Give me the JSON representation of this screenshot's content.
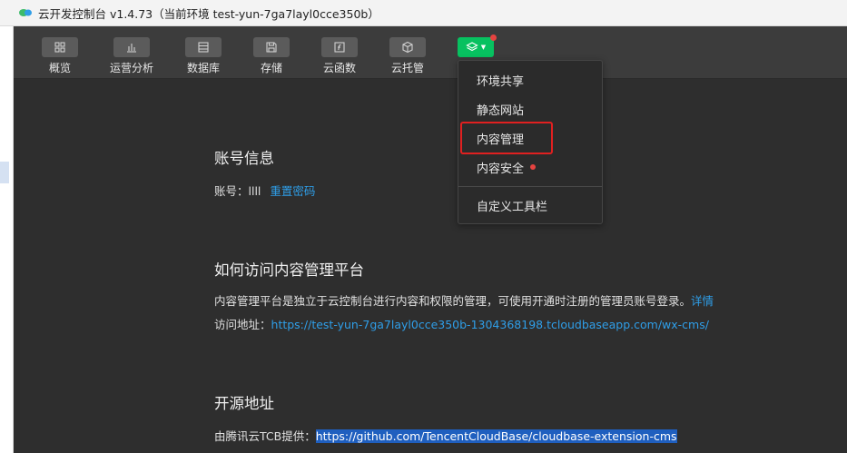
{
  "window": {
    "title": "云开发控制台 v1.4.73（当前环境 test-yun-7ga7layl0cce350b）"
  },
  "toolbar": {
    "items": [
      {
        "label": "概览",
        "icon": "grid-icon"
      },
      {
        "label": "运营分析",
        "icon": "bar-chart-icon"
      },
      {
        "label": "数据库",
        "icon": "database-icon"
      },
      {
        "label": "存储",
        "icon": "save-icon"
      },
      {
        "label": "云函数",
        "icon": "function-icon"
      },
      {
        "label": "云托管",
        "icon": "cube-icon"
      }
    ],
    "extensions_icon": "layers-icon"
  },
  "menu": {
    "items": [
      "环境共享",
      "静态网站",
      "内容管理",
      "内容安全",
      "自定义工具栏"
    ],
    "selected": "内容管理"
  },
  "account": {
    "title": "账号信息",
    "label": "账号：",
    "value": "llll",
    "reset_link": "重置密码"
  },
  "access": {
    "title": "如何访问内容管理平台",
    "description": "内容管理平台是独立于云控制台进行内容和权限的管理，可使用开通时注册的管理员账号登录。",
    "details_link": "详情",
    "url_label": "访问地址：",
    "url": "https://test-yun-7ga7layl0cce350b-1304368198.tcloudbaseapp.com/wx-cms/"
  },
  "opensource": {
    "title": "开源地址",
    "label": "由腾讯云TCB提供：",
    "url": "https://github.com/TencentCloudBase/cloudbase-extension-cms"
  },
  "colors": {
    "background": "#2e2e2e",
    "toolbar": "#3c3c3c",
    "accent_green": "#07c160",
    "link": "#2f9ee8",
    "highlight_border": "#e02020",
    "selection": "#1f5fbf"
  }
}
